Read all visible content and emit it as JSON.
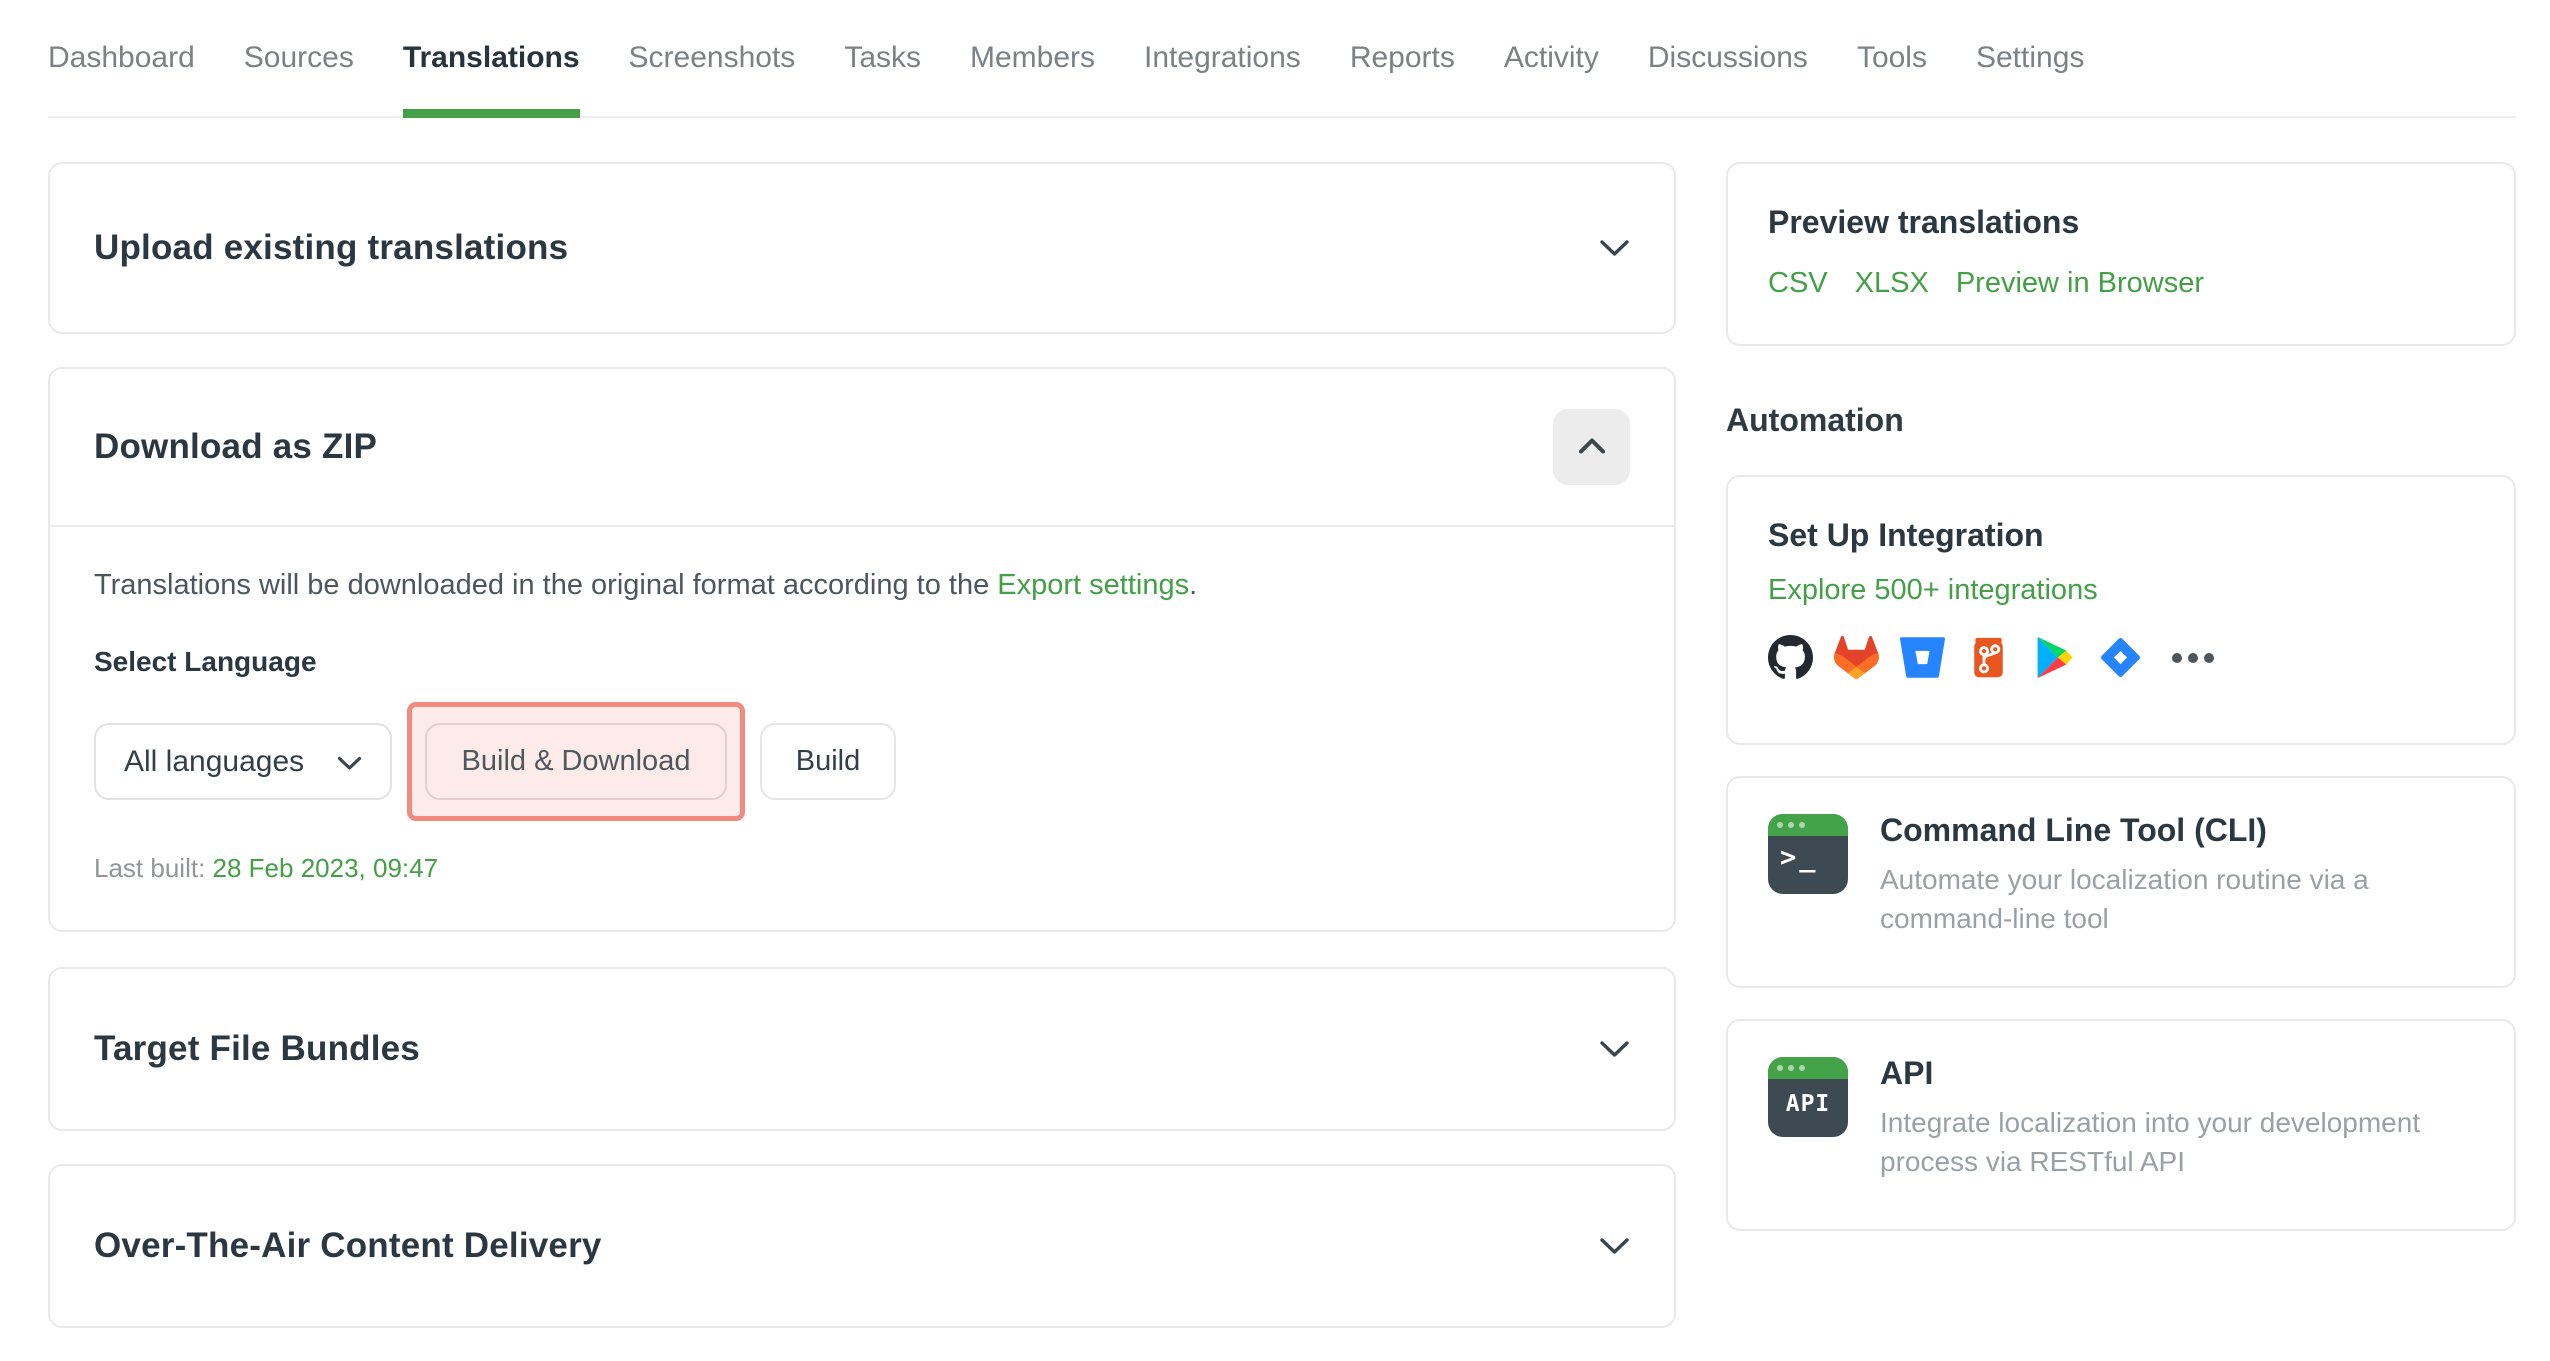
{
  "colors": {
    "accent_green": "#43a047",
    "active_tab_underline": "#43a047",
    "annotation_border": "#f28a80",
    "annotation_fill": "#fcebe9",
    "heading_text": "#2b3841",
    "muted_text": "#9aa1a5",
    "card_border": "#e7e9ea",
    "tool_icon_body": "#3d4a52",
    "tool_icon_bar": "#44a248"
  },
  "nav": {
    "active_tab": "Translations",
    "tabs": [
      {
        "label": "Dashboard"
      },
      {
        "label": "Sources"
      },
      {
        "label": "Translations"
      },
      {
        "label": "Screenshots"
      },
      {
        "label": "Tasks"
      },
      {
        "label": "Members"
      },
      {
        "label": "Integrations"
      },
      {
        "label": "Reports"
      },
      {
        "label": "Activity"
      },
      {
        "label": "Discussions"
      },
      {
        "label": "Tools"
      },
      {
        "label": "Settings"
      }
    ]
  },
  "main": {
    "upload_panel": {
      "title": "Upload existing translations"
    },
    "download_panel": {
      "title": "Download as ZIP",
      "description_prefix": "Translations will be downloaded in the original format according to the ",
      "description_link": "Export settings",
      "description_suffix": ".",
      "select_label": "Select Language",
      "language_select_value": "All languages",
      "build_download_label": "Build & Download",
      "build_label": "Build",
      "last_built_label": "Last built:",
      "last_built_value": "28 Feb 2023, 09:47"
    },
    "target_panel": {
      "title": "Target File Bundles"
    },
    "ota_panel": {
      "title": "Over-The-Air Content Delivery"
    }
  },
  "sidebar": {
    "preview": {
      "title": "Preview translations",
      "links": [
        {
          "label": "CSV"
        },
        {
          "label": "XLSX"
        },
        {
          "label": "Preview in Browser"
        }
      ]
    },
    "automation_heading": "Automation",
    "integration": {
      "title": "Set Up Integration",
      "link": "Explore 500+ integrations",
      "icons": [
        "github-icon",
        "gitlab-icon",
        "bitbucket-icon",
        "git-branch-icon",
        "google-play-icon",
        "jira-icon",
        "more-icon"
      ]
    },
    "cli": {
      "title": "Command Line Tool (CLI)",
      "description": "Automate your localization routine via a command-line tool",
      "icon_text": ">_"
    },
    "api": {
      "title": "API",
      "description": "Integrate localization into your development process via RESTful API",
      "icon_text": "API"
    }
  }
}
